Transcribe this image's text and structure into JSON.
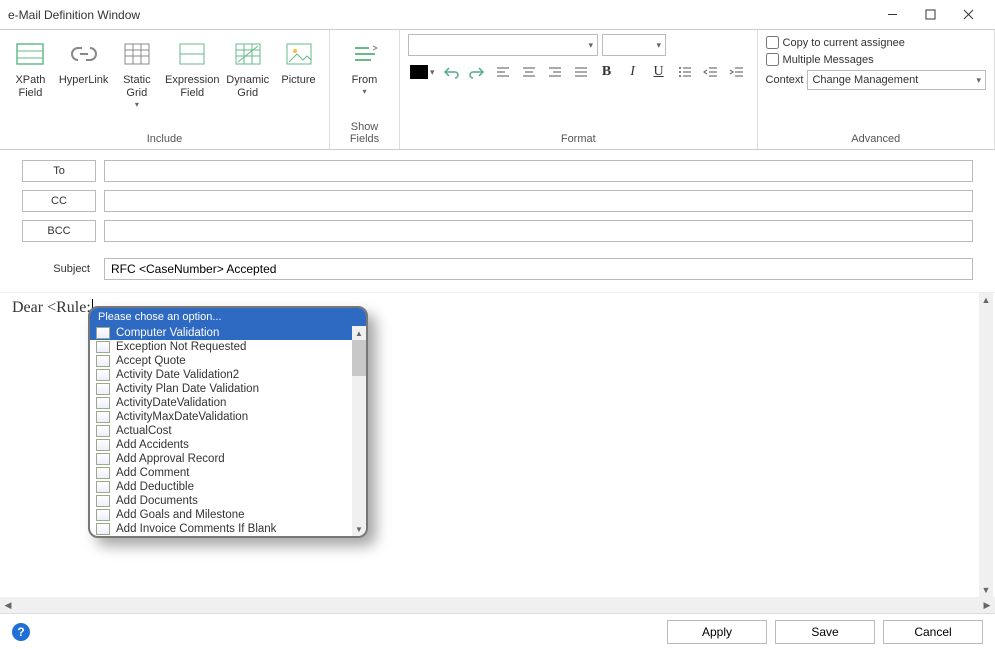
{
  "window": {
    "title": "e-Mail Definition Window"
  },
  "ribbon": {
    "include": {
      "label": "Include",
      "xpath_field": "XPath\nField",
      "hyperlink": "HyperLink",
      "static_grid": "Static\nGrid",
      "expression_field": "Expression\nField",
      "dynamic_grid": "Dynamic\nGrid",
      "picture": "Picture"
    },
    "show_fields": {
      "label": "Show Fields",
      "from": "From"
    },
    "format": {
      "label": "Format"
    },
    "advanced": {
      "label": "Advanced",
      "copy_assignee": "Copy to current assignee",
      "multiple_messages": "Multiple Messages",
      "context_label": "Context",
      "context_value": "Change Management"
    }
  },
  "fields": {
    "to": "To",
    "cc": "CC",
    "bcc": "BCC",
    "subject_label": "Subject",
    "subject_value": "RFC <CaseNumber> Accepted"
  },
  "editor": {
    "body_text": "Dear <Rule:"
  },
  "suggest": {
    "header": "Please chose an option...",
    "items": [
      "Computer Validation",
      "Exception Not Requested",
      "Accept Quote",
      "Activity Date Validation2",
      "Activity Plan Date Validation",
      "ActivityDateValidation",
      "ActivityMaxDateValidation",
      "ActualCost",
      "Add Accidents",
      "Add Approval Record",
      "Add Comment",
      "Add Deductible",
      "Add Documents",
      "Add Goals and Milestone",
      "Add Invoice Comments If Blank"
    ],
    "selected_index": 0
  },
  "footer": {
    "apply": "Apply",
    "save": "Save",
    "cancel": "Cancel"
  }
}
